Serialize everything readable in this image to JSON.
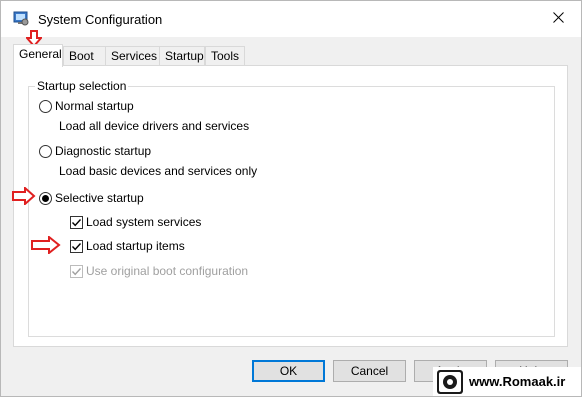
{
  "window": {
    "title": "System Configuration",
    "icon": "system-config-icon",
    "close_icon": "close-icon"
  },
  "tabs": [
    {
      "label": "General",
      "active": true
    },
    {
      "label": "Boot",
      "active": false
    },
    {
      "label": "Services",
      "active": false
    },
    {
      "label": "Startup",
      "active": false
    },
    {
      "label": "Tools",
      "active": false
    }
  ],
  "startup_selection": {
    "legend": "Startup selection",
    "normal": {
      "label": "Normal startup",
      "description": "Load all device drivers and services",
      "selected": false
    },
    "diagnostic": {
      "label": "Diagnostic startup",
      "description": "Load basic devices and services only",
      "selected": false
    },
    "selective": {
      "label": "Selective startup",
      "selected": true
    },
    "options": [
      {
        "label": "Load system services",
        "checked": true,
        "enabled": true
      },
      {
        "label": "Load startup items",
        "checked": true,
        "enabled": true
      },
      {
        "label": "Use original boot configuration",
        "checked": true,
        "enabled": false
      }
    ]
  },
  "buttons": {
    "ok": "OK",
    "cancel": "Cancel",
    "apply": "Apply",
    "help": "Help"
  },
  "annotation_color": "#e02020",
  "accent_color": "#0078d7",
  "watermark": {
    "text": "www.Romaak.ir"
  }
}
